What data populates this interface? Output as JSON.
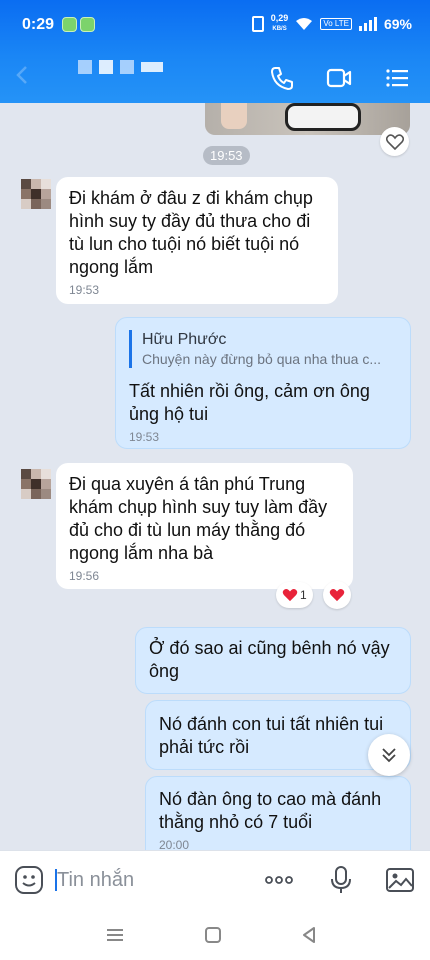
{
  "status_bar": {
    "time": "0:29",
    "speed_value": "0,29",
    "speed_unit": "KB/S",
    "volte": "Vo LTE",
    "battery": "69%"
  },
  "header": {
    "contact_name_blurred": true
  },
  "chat": {
    "time_separator": "19:53",
    "messages": [
      {
        "direction": "in",
        "text": "Đi khám ở đâu z đi khám chụp hình suy ty đầy đủ thưa cho đi tù lun cho tuội nó biết tuội nó ngong lắm",
        "time": "19:53"
      },
      {
        "direction": "out",
        "quote_name": "Hữu Phước",
        "quote_text": "Chuyện này đừng bỏ qua nha thua c...",
        "text": "Tất nhiên rồi ông, cảm ơn ông ủng hộ tui",
        "time": "19:53"
      },
      {
        "direction": "in",
        "text": "Đi qua xuyên á tân phú Trung khám chụp hình suy tuy làm đầy đủ cho đi tù lun máy thằng đó ngong lắm nha bà",
        "time": "19:56",
        "reaction_count": "1"
      },
      {
        "direction": "out",
        "text": "Ở đó sao ai cũng bênh nó vậy ông"
      },
      {
        "direction": "out",
        "text": "Nó đánh con tui tất nhiên tui phải tức rồi"
      },
      {
        "direction": "out",
        "text": "Nó đàn ông to cao mà đánh thằng nhỏ có 7 tuổi",
        "time": "20:00"
      }
    ]
  },
  "input": {
    "placeholder": "Tin nhắn"
  },
  "colors": {
    "header_blue": "#1a86f5",
    "out_bubble": "#d6eaff",
    "in_bubble": "#ffffff",
    "chat_bg": "#e1e6ef",
    "heart_red": "#e8233a"
  },
  "icons": [
    "phone-icon",
    "video-call-icon",
    "menu-icon",
    "emoji-icon",
    "more-icon",
    "microphone-icon",
    "image-icon",
    "heart-icon",
    "chevron-double-down-icon"
  ]
}
